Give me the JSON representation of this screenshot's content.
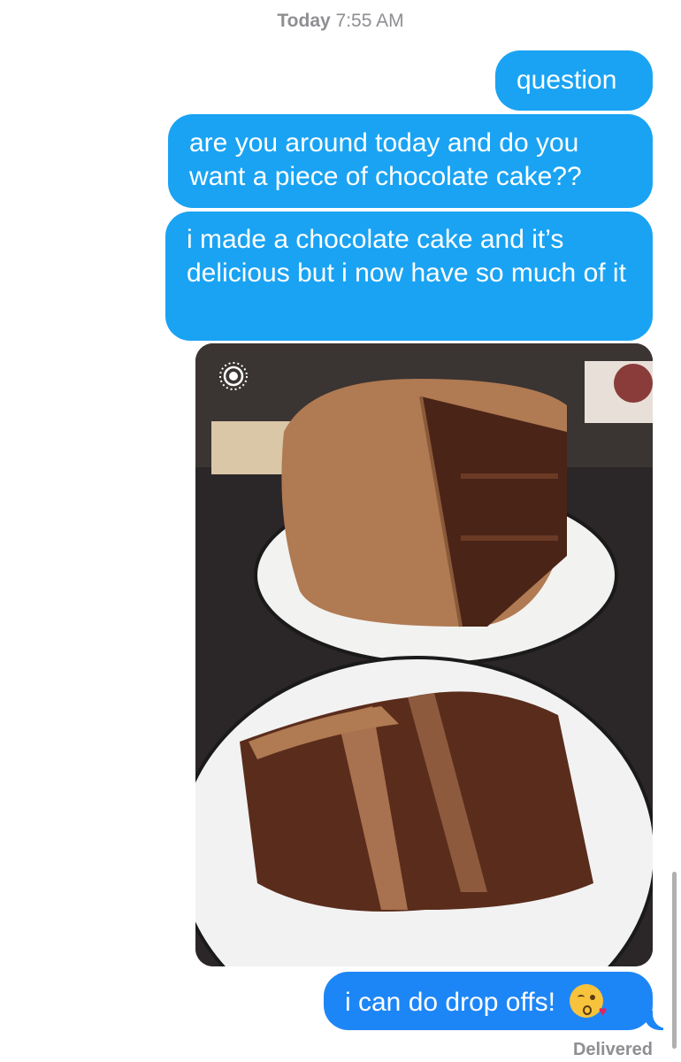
{
  "header": {
    "day": "Today",
    "time": "7:55 AM"
  },
  "messages": [
    {
      "text": "question"
    },
    {
      "text": "are you around today and do you want a piece of chocolate cake??"
    },
    {
      "text": "i made a chocolate cake and it’s delicious but i now have so much of it"
    },
    {
      "text": "i can do drop offs!"
    }
  ],
  "photo": {
    "icon": "live-photo-icon"
  },
  "emoji": "kissing-face-icon",
  "status": "Delivered",
  "colors": {
    "incoming_bubble": "#1aa3f3",
    "sent_bubble": "#1d86f6",
    "meta": "#8e8e93"
  }
}
